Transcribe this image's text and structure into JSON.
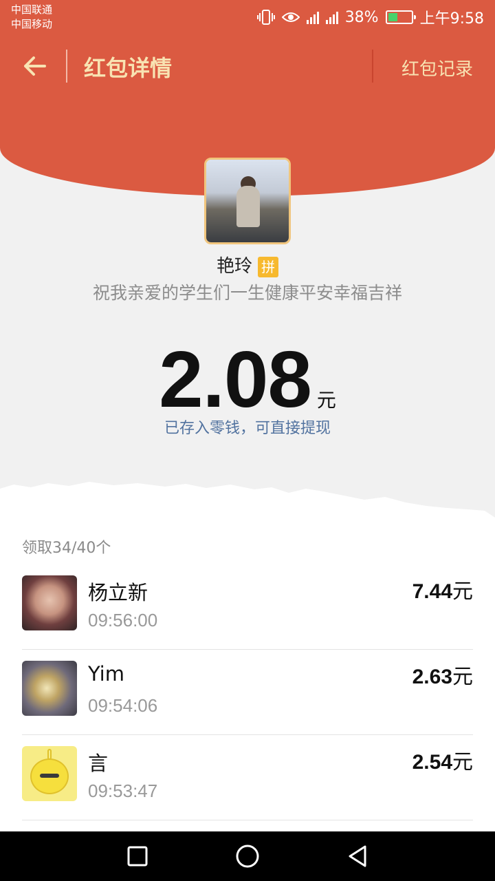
{
  "status_bar": {
    "carrier1": "中国联通",
    "carrier2": "中国移动",
    "battery": "38%",
    "time": "上午9:58",
    "icons": [
      "vibrate-icon",
      "eye-icon",
      "signal-4g-icon",
      "signal-2g-icon",
      "battery-icon"
    ]
  },
  "nav": {
    "title": "红包详情",
    "record": "红包记录",
    "back_icon": "arrow-left-icon"
  },
  "sender": {
    "name": "艳玲",
    "tag": "拼",
    "blessing": "祝我亲爱的学生们一生健康平安幸福吉祥"
  },
  "amount": {
    "value": "2.08",
    "unit": "元",
    "note": "已存入零钱，可直接提现"
  },
  "list": {
    "header": "领取34/40个",
    "rows": [
      {
        "name": "杨立新",
        "time": "09:56:00",
        "amount": "7.44",
        "unit": "元"
      },
      {
        "name": "Yim",
        "time": "09:54:06",
        "amount": "2.63",
        "unit": "元"
      },
      {
        "name": "言",
        "time": "09:53:47",
        "amount": "2.54",
        "unit": "元"
      }
    ]
  },
  "system_nav": {
    "icons": [
      "square-icon",
      "circle-icon",
      "triangle-back-icon"
    ]
  },
  "colors": {
    "header_red": "#db5a41",
    "title_gold": "#f8e3b2",
    "link_blue": "#51729f"
  }
}
